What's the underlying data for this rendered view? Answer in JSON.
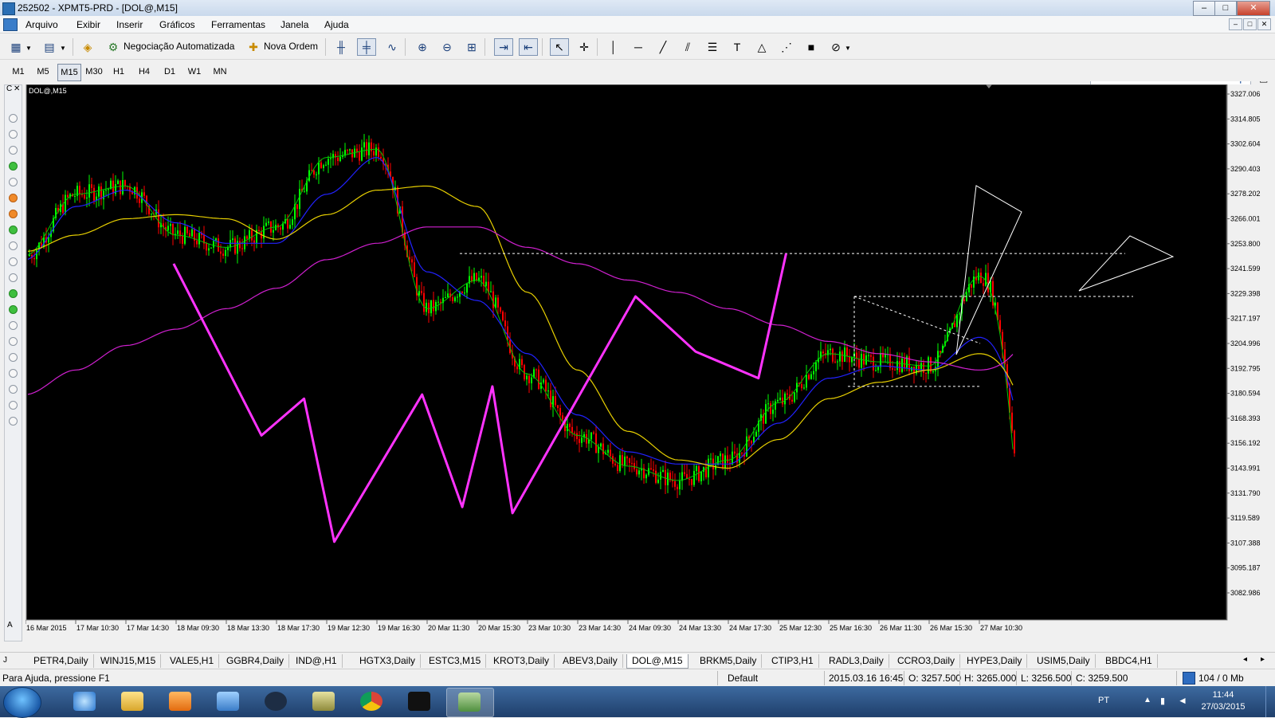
{
  "window": {
    "title": "252502 - XPMT5-PRD - [DOL@,M15]",
    "controls": {
      "minimize": "–",
      "maximize": "□",
      "close": "✕"
    }
  },
  "menu": [
    "Arquivo",
    "Exibir",
    "Inserir",
    "Gráficos",
    "Ferramentas",
    "Janela",
    "Ajuda"
  ],
  "toolbar": {
    "auto_trading_label": "Negociação Automatizada",
    "new_order_label": "Nova Ordem",
    "search_placeholder": ""
  },
  "timeframes": {
    "items": [
      "M1",
      "M5",
      "M15",
      "M30",
      "H1",
      "H4",
      "D1",
      "W1",
      "MN"
    ],
    "active": "M15"
  },
  "chart": {
    "label": "DOL@,M15",
    "colors": {
      "background": "#000000",
      "bull": "#00ff00",
      "bear": "#ff0000",
      "ma_fast": "#00c800",
      "ma_mid": "#2222ff",
      "ma_slow": "#e8d000",
      "ma_long": "#d020d0",
      "zigzag": "#ff33ff",
      "pattern": "#ffffff"
    }
  },
  "chart_data": {
    "type": "line",
    "title": "DOL@,M15",
    "x": [
      "16 Mar 2015",
      "17 Mar 10:30",
      "17 Mar 14:30",
      "18 Mar 09:30",
      "18 Mar 13:30",
      "18 Mar 17:30",
      "19 Mar 12:30",
      "19 Mar 16:30",
      "20 Mar 11:30",
      "20 Mar 15:30",
      "23 Mar 10:30",
      "23 Mar 14:30",
      "24 Mar 09:30",
      "24 Mar 13:30",
      "24 Mar 17:30",
      "25 Mar 12:30",
      "25 Mar 16:30",
      "26 Mar 11:30",
      "26 Mar 15:30",
      "27 Mar 10:30"
    ],
    "y_ticks": [
      "3327.006",
      "3314.805",
      "3302.604",
      "3290.403",
      "3278.202",
      "3266.001",
      "3253.800",
      "3241.599",
      "3229.398",
      "3217.197",
      "3204.996",
      "3192.795",
      "3180.594",
      "3168.393",
      "3156.192",
      "3143.991",
      "3131.790",
      "3119.589",
      "3107.388",
      "3095.187",
      "3082.986"
    ],
    "ylim": [
      3077,
      3330
    ],
    "series": [
      {
        "values": [
          3248,
          3278,
          3282,
          3258,
          3252,
          3262,
          3296,
          3300,
          3222,
          3236,
          3190,
          3160,
          3145,
          3138,
          3148,
          3176,
          3200,
          3196,
          3194,
          3238
        ]
      },
      {
        "values": [
          3246,
          3272,
          3280,
          3264,
          3254,
          3254,
          3278,
          3296,
          3240,
          3226,
          3200,
          3170,
          3152,
          3146,
          3146,
          3166,
          3188,
          3194,
          3192,
          3208
        ]
      },
      {
        "values": [
          3250,
          3258,
          3266,
          3268,
          3266,
          3256,
          3268,
          3280,
          3282,
          3272,
          3230,
          3192,
          3162,
          3148,
          3144,
          3158,
          3178,
          3186,
          3192,
          3200
        ]
      },
      {
        "values": [
          3180,
          3192,
          3204,
          3212,
          3222,
          3232,
          3246,
          3254,
          3262,
          3262,
          3252,
          3244,
          3236,
          3230,
          3222,
          3214,
          3206,
          3200,
          3196,
          3192
        ]
      }
    ],
    "zigzag": [
      [
        2.95,
        3244
      ],
      [
        4.7,
        3160
      ],
      [
        5.55,
        3178
      ],
      [
        6.15,
        3108
      ],
      [
        7.9,
        3180
      ],
      [
        8.7,
        3125
      ],
      [
        9.3,
        3184
      ],
      [
        9.7,
        3122
      ],
      [
        12.15,
        3228
      ],
      [
        13.35,
        3201
      ],
      [
        14.6,
        3188
      ],
      [
        15.15,
        3249
      ]
    ],
    "channel_levels": [
      3249,
      3228,
      3184
    ],
    "grid": false,
    "legend": "none"
  },
  "tabs": {
    "items": [
      "PETR4,Daily",
      "WINJ15,M15",
      "VALE5,H1",
      "GGBR4,Daily",
      "IND@,H1",
      "HGTX3,Daily",
      "ESTC3,M15",
      "KROT3,Daily",
      "ABEV3,Daily",
      "DOL@,M15",
      "BRKM5,Daily",
      "CTIP3,H1",
      "RADL3,Daily",
      "CCRO3,Daily",
      "HYPE3,Daily",
      "USIM5,Daily",
      "BBDC4,H1"
    ],
    "active": "DOL@,M15"
  },
  "status": {
    "help": "Para Ajuda, pressione F1",
    "profile": "Default",
    "datetime": "2015.03.16 16:45",
    "open": "O: 3257.500",
    "high": "H: 3265.000",
    "low": "L: 3256.500",
    "close": "C: 3259.500",
    "traffic": "104 / 0 Mb"
  },
  "taskbar": {
    "language": "PT",
    "time": "11:44",
    "date": "27/03/2015"
  }
}
